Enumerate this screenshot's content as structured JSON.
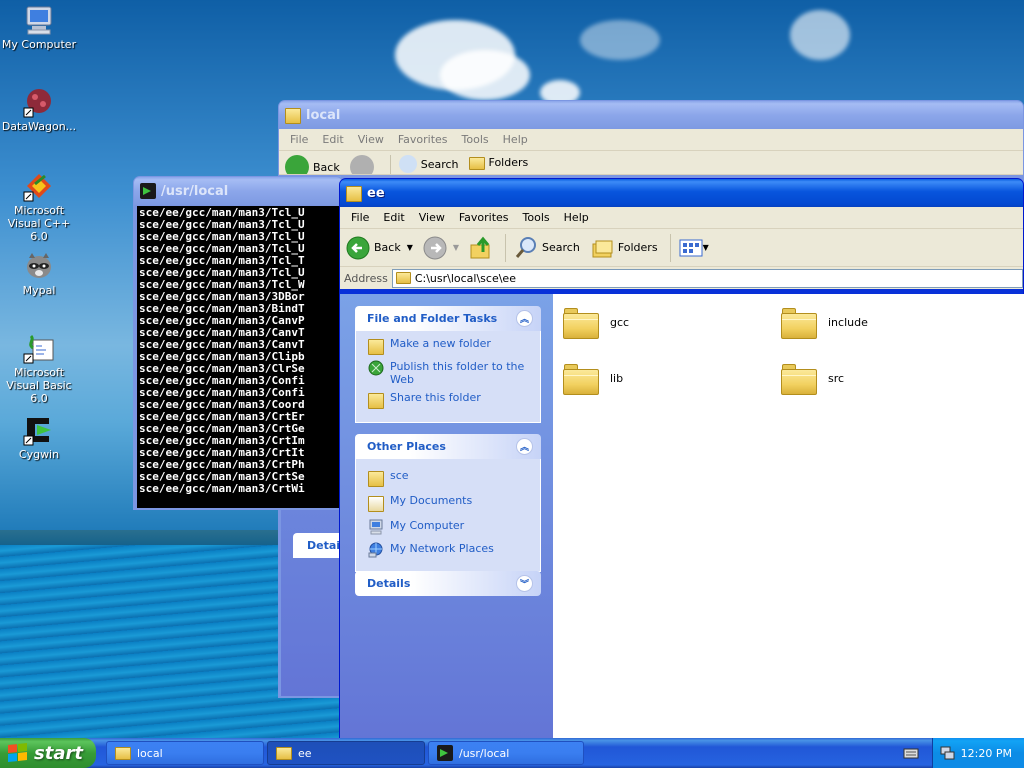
{
  "desktop": {
    "icons": [
      {
        "label": "My Computer"
      },
      {
        "label": "DataWagon..."
      },
      {
        "label": "Microsoft Visual C++ 6.0"
      },
      {
        "label": "Mypal"
      },
      {
        "label": "Microsoft Visual Basic 6.0"
      },
      {
        "label": "Cygwin"
      }
    ]
  },
  "local_window": {
    "title": "local",
    "menu": [
      "File",
      "Edit",
      "View",
      "Favorites",
      "Tools",
      "Help"
    ],
    "toolbar": {
      "back": "Back",
      "search": "Search",
      "folders": "Folders"
    },
    "details_label": "Detail"
  },
  "console_window": {
    "title": "/usr/local",
    "lines": [
      "sce/ee/gcc/man/man3/Tcl_U",
      "sce/ee/gcc/man/man3/Tcl_U",
      "sce/ee/gcc/man/man3/Tcl_U",
      "sce/ee/gcc/man/man3/Tcl_U",
      "sce/ee/gcc/man/man3/Tcl_T",
      "sce/ee/gcc/man/man3/Tcl_U",
      "sce/ee/gcc/man/man3/Tcl_W",
      "sce/ee/gcc/man/man3/3DBor",
      "sce/ee/gcc/man/man3/BindT",
      "sce/ee/gcc/man/man3/CanvP",
      "sce/ee/gcc/man/man3/CanvT",
      "sce/ee/gcc/man/man3/CanvT",
      "sce/ee/gcc/man/man3/Clipb",
      "sce/ee/gcc/man/man3/ClrSe",
      "sce/ee/gcc/man/man3/Confi",
      "sce/ee/gcc/man/man3/Confi",
      "sce/ee/gcc/man/man3/Coord",
      "sce/ee/gcc/man/man3/CrtEr",
      "sce/ee/gcc/man/man3/CrtGe",
      "sce/ee/gcc/man/man3/CrtIm",
      "sce/ee/gcc/man/man3/CrtIt",
      "sce/ee/gcc/man/man3/CrtPh",
      "sce/ee/gcc/man/man3/CrtSe",
      "sce/ee/gcc/man/man3/CrtWi"
    ]
  },
  "ee_window": {
    "title": "ee",
    "menu": [
      "File",
      "Edit",
      "View",
      "Favorites",
      "Tools",
      "Help"
    ],
    "toolbar": {
      "back": "Back",
      "search": "Search",
      "folders": "Folders"
    },
    "address_label": "Address",
    "address_value": "C:\\usr\\local\\sce\\ee",
    "tasks": {
      "title": "File and Folder Tasks",
      "items": [
        "Make a new folder",
        "Publish this folder to the Web",
        "Share this folder"
      ]
    },
    "other_places": {
      "title": "Other Places",
      "items": [
        "sce",
        "My Documents",
        "My Computer",
        "My Network Places"
      ]
    },
    "details": {
      "title": "Details"
    },
    "files": [
      "gcc",
      "include",
      "lib",
      "src"
    ]
  },
  "taskbar": {
    "start_label": "start",
    "tasks": [
      "local",
      "ee",
      "/usr/local"
    ],
    "clock": "12:20 PM"
  },
  "colors": {
    "xp_blue": "#0831d9",
    "task_link": "#215dc6",
    "start_green": "#379d37"
  }
}
